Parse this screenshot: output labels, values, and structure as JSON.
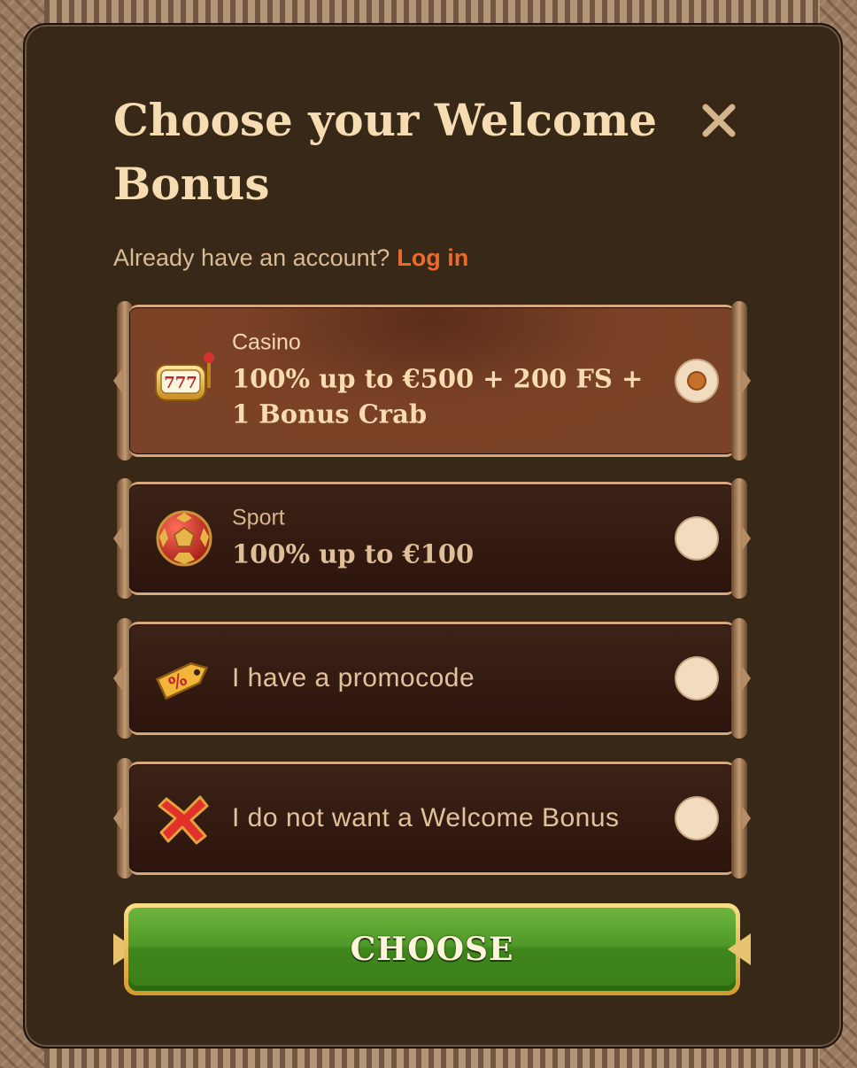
{
  "modal": {
    "title": "Choose your Welcome Bonus",
    "account_prompt": "Already have an account?",
    "login_link": "Log in",
    "choose_button": "CHOOSE"
  },
  "options": [
    {
      "category": "Casino",
      "bonus": "100% up to €500 + 200 FS + 1 Bonus Crab",
      "icon": "slot-machine-777-icon",
      "selected": true
    },
    {
      "category": "Sport",
      "bonus": "100% up to €100",
      "icon": "soccer-ball-icon",
      "selected": false
    },
    {
      "label": "I have a promocode",
      "icon": "percent-tag-icon",
      "selected": false
    },
    {
      "label": "I do not want a Welcome Bonus",
      "icon": "red-x-icon",
      "selected": false
    }
  ],
  "colors": {
    "modal_bg": "#382818",
    "title": "#f6dcb0",
    "login_link": "#ec6a2b",
    "button_green": "#4f9a28",
    "button_gold": "#e8c470"
  }
}
